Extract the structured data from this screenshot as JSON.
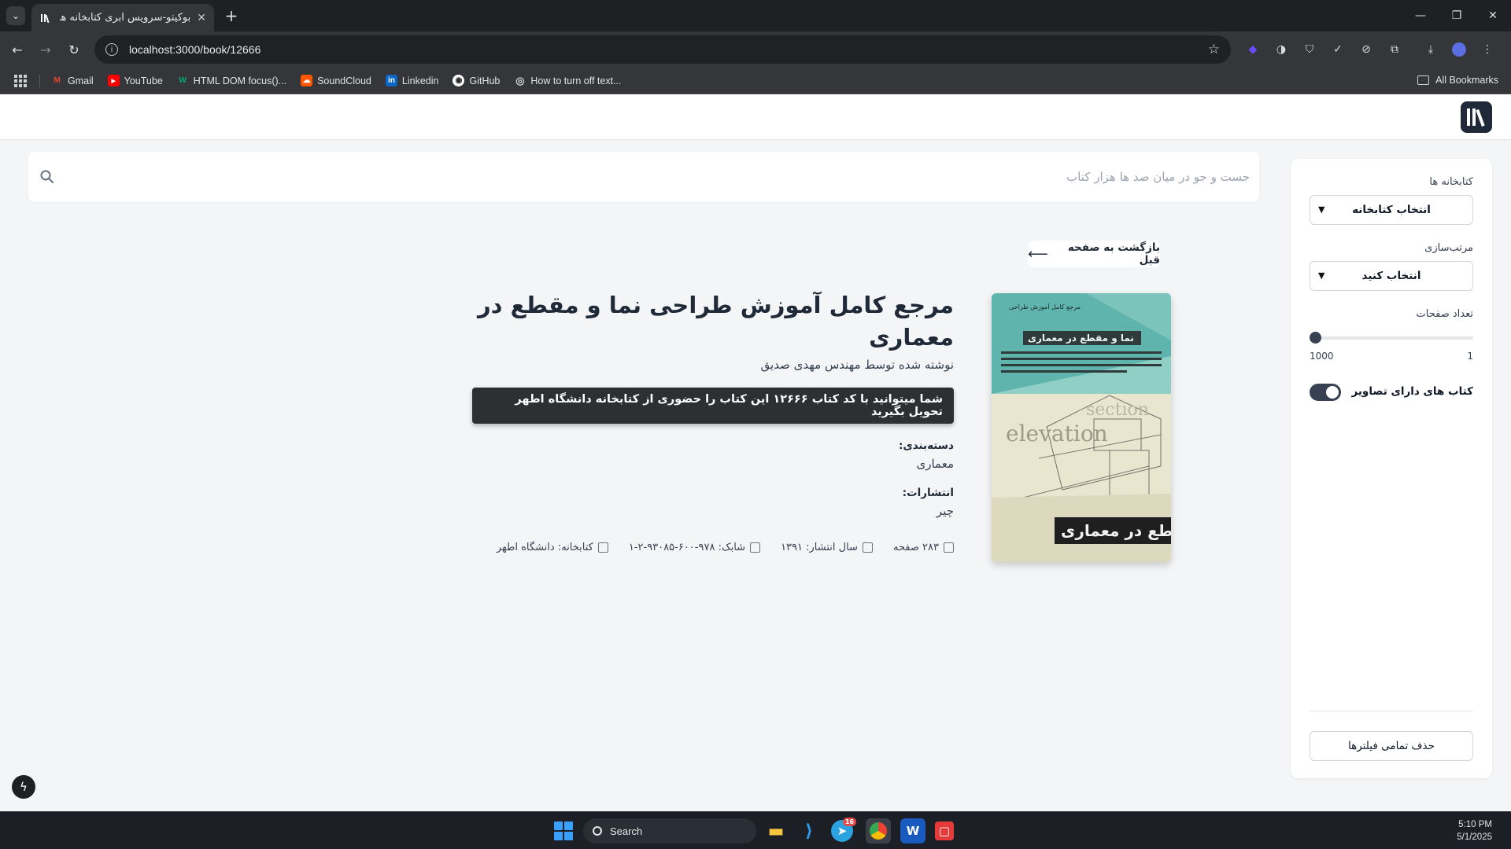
{
  "browser": {
    "tab_title": "بوکیتو-سرویس ابری کتابخانه های",
    "url": "localhost:3000/book/12666",
    "bookmarks": [
      {
        "label": "Gmail",
        "icon": "gmail-icon",
        "color": "#ea4335"
      },
      {
        "label": "YouTube",
        "icon": "youtube-icon",
        "color": "#ff0000"
      },
      {
        "label": "HTML DOM focus()...",
        "icon": "w3schools-icon",
        "color": "#04aa6d"
      },
      {
        "label": "SoundCloud",
        "icon": "soundcloud-icon",
        "color": "#ff5500"
      },
      {
        "label": "Linkedin",
        "icon": "linkedin-icon",
        "color": "#0a66c2"
      },
      {
        "label": "GitHub",
        "icon": "github-icon",
        "color": "#ffffff"
      },
      {
        "label": "How to turn off text...",
        "icon": "globe-icon",
        "color": "#cfcfcf"
      }
    ],
    "all_bookmarks": "All Bookmarks"
  },
  "search": {
    "placeholder": "جست و جو در میان صد ها هزار کتاب"
  },
  "sidebar": {
    "libraries_label": "کتابخانه ها",
    "libraries_value": "انتخاب کتابخانه",
    "sort_label": "مرتب‌سازی",
    "sort_value": "انتخاب کنید",
    "pages_label": "تعداد صفحات",
    "pages_min": "1",
    "pages_max": "1000",
    "pages_slider_value": 1,
    "images_toggle_label": "کتاب های دارای تصاویر",
    "images_toggle_on": true,
    "clear_filters": "حذف تمامی فیلترها"
  },
  "book": {
    "back_label": "بازگشت به صفحه قبل",
    "title": "مرجع کامل آموزش طراحی نما و مقطع در معماری",
    "author_line": "نوشته شده توسط مهندس مهدی صدیق",
    "pickup_note": "شما میتوانید با کد کتاب ۱۲۶۶۶ این کتاب را حضوری از کتابخانه دانشگاه اطهر تحویل بگیرید",
    "category_label": "دسته‌بندی:",
    "category_value": "معماری",
    "publisher_label": "انتشارات:",
    "publisher_value": "چیر",
    "meta": {
      "pages": "۲۸۳ صفحه",
      "year": "سال انتشار: ۱۳۹۱",
      "isbn": "شابک: ۹۷۸-۶۰۰-۹۳۰۸۵-۲-۱",
      "library": "کتابخانه: دانشگاه اطهر"
    },
    "cover": {
      "top_small_text": "مرجع کامل آموزش طراحی",
      "band_text": "نما و مقطع در معماری",
      "word_section": "section",
      "word_elevation": "elevation",
      "bottom_text": "مقطع در معماری",
      "top_color": "#5fb5ad",
      "bottom_color": "#e9e6cf"
    }
  },
  "taskbar": {
    "search_label": "Search",
    "telegram_badge": "16",
    "time": "5:10 PM",
    "date": "5/1/2025"
  }
}
